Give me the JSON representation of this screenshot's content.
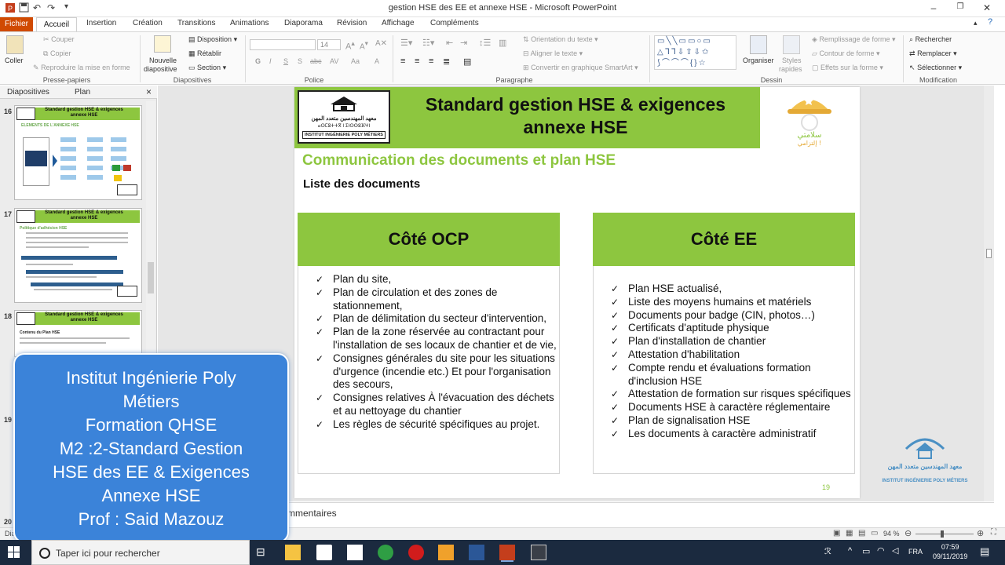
{
  "window": {
    "title": "gestion HSE des EE et annexe HSE - Microsoft PowerPoint",
    "minimize": "–",
    "restore": "❐",
    "close": "✕"
  },
  "tabs": {
    "file": "Fichier",
    "items": [
      "Accueil",
      "Insertion",
      "Création",
      "Transitions",
      "Animations",
      "Diaporama",
      "Révision",
      "Affichage",
      "Compléments"
    ]
  },
  "ribbon": {
    "clipboard": {
      "paste": "Coller",
      "cut": "Couper",
      "copy": "Copier",
      "format_painter": "Reproduire la mise en forme",
      "label": "Presse-papiers"
    },
    "slides": {
      "new_slide_1": "Nouvelle",
      "new_slide_2": "diapositive",
      "layout": "Disposition",
      "reset": "Rétablir",
      "section": "Section",
      "label": "Diapositives"
    },
    "font": {
      "size": "14",
      "label": "Police",
      "b": "G",
      "i": "I",
      "u": "S",
      "s": "S",
      "abc": "abc",
      "av": "AV",
      "aa": "Aa",
      "a": "A"
    },
    "paragraph": {
      "text_direction": "Orientation du texte",
      "align_text": "Aligner le texte",
      "smartart": "Convertir en graphique SmartArt",
      "label": "Paragraphe"
    },
    "drawing": {
      "arrange": "Organiser",
      "styles_1": "Styles",
      "styles_2": "rapides",
      "fill": "Remplissage de forme",
      "outline": "Contour de forme",
      "effects": "Effets sur la forme",
      "label": "Dessin"
    },
    "editing": {
      "find": "Rechercher",
      "replace": "Remplacer",
      "select": "Sélectionner",
      "label": "Modification"
    }
  },
  "pane": {
    "tab_slides": "Diapositives",
    "tab_outline": "Plan",
    "close": "×",
    "thumbs": [
      {
        "num": "16",
        "title": "Standard gestion HSE & exigences annexe HSE",
        "sub": "ELEMENTS DE L'ANNEXE HSE"
      },
      {
        "num": "17",
        "title": "Standard gestion HSE & exigences annexe HSE",
        "sub": "Politique d'adhésion HSE"
      },
      {
        "num": "18",
        "title": "Standard gestion HSE & exigences annexe HSE",
        "sub": "Contenu du Plan HSE"
      },
      {
        "num": "19"
      },
      {
        "num": "20"
      }
    ]
  },
  "slide": {
    "title_line1": "Standard gestion HSE & exigences",
    "title_line2": "annexe HSE",
    "logo_text_ar": "معهد المهندسين متعدد المهن",
    "logo_text_tifinagh": "ⴰⵙⵎⵓⵜⵜⴳ ⵏ ⵉⵏⵙⵙⵓⴼⵖⵏ",
    "logo_text_fr": "INSTITUT INGÉNIERIE POLY MÉTIERS",
    "logo_short": "IIPM",
    "subtitle": "Communication des documents et plan HSE",
    "list_title": "Liste des documents",
    "col1": {
      "head": "Côté OCP",
      "items": [
        "Plan du site,",
        "Plan de circulation et des zones de stationnement,",
        "Plan de délimitation du secteur d'intervention,",
        "Plan de la zone réservée au contractant pour l'installation de ses locaux de chantier et de vie,",
        "Consignes générales du site pour les situations d'urgence (incendie etc.) Et pour l'organisation des secours,",
        "Consignes relatives À l'évacuation des déchets et au nettoyage du chantier",
        "Les règles de sécurité spécifiques au projet."
      ]
    },
    "col2": {
      "head": "Côté EE",
      "items": [
        "Plan HSE actualisé,",
        "Liste des moyens humains et matériels",
        "Documents pour badge (CIN, photos…)",
        "Certificats d'aptitude physique",
        "Plan d'installation de chantier",
        "Attestation d'habilitation",
        "Compte rendu et évaluations formation d'inclusion HSE",
        "Attestation de formation sur risques spécifiques",
        "Documents HSE à caractère réglementaire",
        "Plan de signalisation HSE",
        "Les documents à caractère administratif"
      ]
    },
    "number": "19"
  },
  "side_logo": {
    "ar": "معهد المهندسين متعدد المهن",
    "fr": "INSTITUT INGÉNIERIE POLY MÉTIERS",
    "short": "IIPM"
  },
  "comments": {
    "label": "mmentaires"
  },
  "status": {
    "left": "Diap",
    "zoom": "94 %"
  },
  "overlay": {
    "lines": [
      "Institut Ingénierie Poly",
      "Métiers",
      "Formation QHSE",
      "M2 :2-Standard Gestion",
      "HSE des EE & Exigences",
      "Annexe HSE",
      "Prof : Said Mazouz"
    ]
  },
  "taskbar": {
    "search": "Taper ici pour rechercher",
    "lang": "FRA",
    "time": "07:59",
    "date": "09/11/2019"
  },
  "colors": {
    "green": "#8dc63f",
    "overlay": "#3b83d9",
    "file_tab": "#d04a02",
    "taskbar": "#1b2a3f"
  }
}
